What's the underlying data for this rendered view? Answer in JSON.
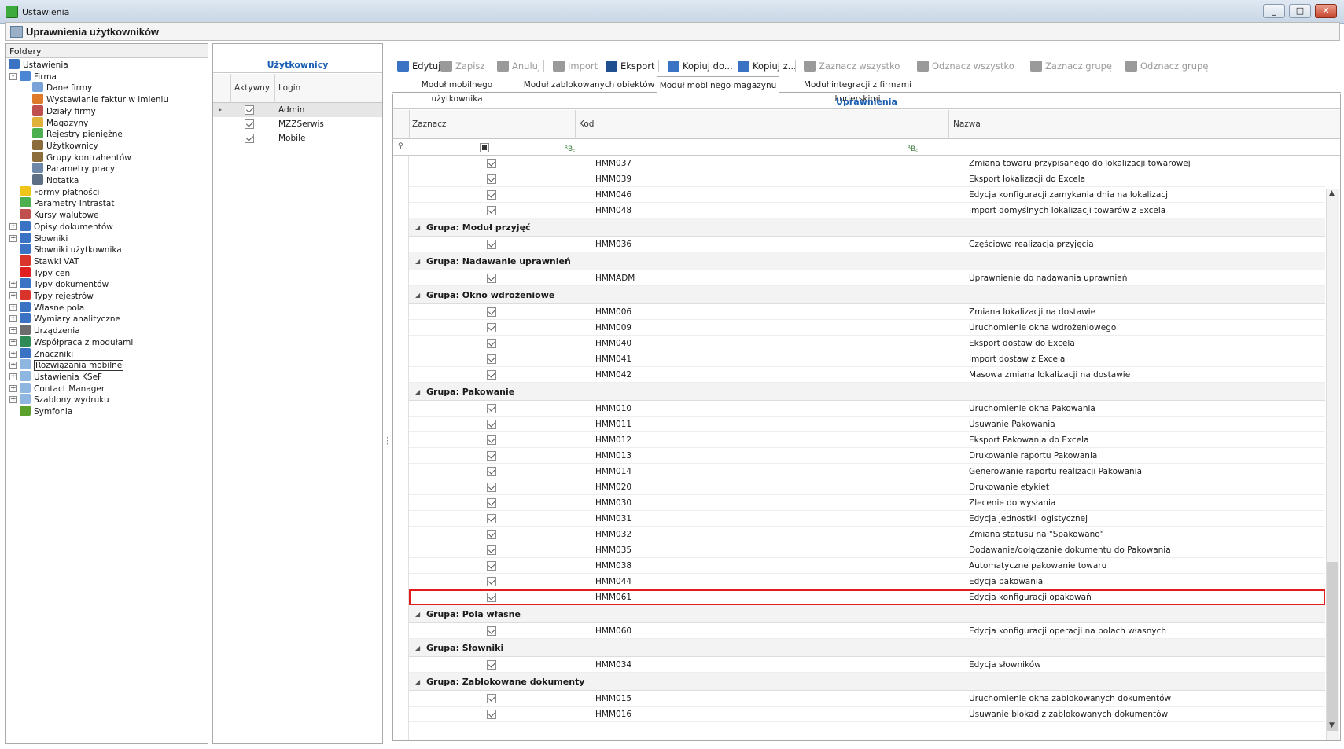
{
  "window": {
    "title": "Ustawienia",
    "controls": [
      "_",
      "□",
      "✕"
    ]
  },
  "header": {
    "title": "Uprawnienia użytkowników"
  },
  "folders": {
    "label": "Foldery",
    "items": [
      {
        "label": "Ustawienia",
        "depth": 0,
        "icon": "tools-icon",
        "color": "#3a73c4"
      },
      {
        "label": "Firma",
        "depth": 1,
        "icon": "company-icon",
        "color": "#4a86d4",
        "expander": "-"
      },
      {
        "label": "Dane firmy",
        "depth": 2,
        "icon": "document-icon",
        "color": "#7aa2d8"
      },
      {
        "label": "Wystawianie faktur w imieniu",
        "depth": 2,
        "icon": "person-icon",
        "color": "#e07a2b"
      },
      {
        "label": "Działy firmy",
        "depth": 2,
        "icon": "people-icon",
        "color": "#c0504d"
      },
      {
        "label": "Magazyny",
        "depth": 2,
        "icon": "warehouse-icon",
        "color": "#e0b23a"
      },
      {
        "label": "Rejestry pieniężne",
        "depth": 2,
        "icon": "money-icon",
        "color": "#4caf50"
      },
      {
        "label": "Użytkownicy",
        "depth": 2,
        "icon": "users-icon",
        "color": "#8a6d3b"
      },
      {
        "label": "Grupy kontrahentów",
        "depth": 2,
        "icon": "groups-icon",
        "color": "#8a6d3b"
      },
      {
        "label": "Parametry pracy",
        "depth": 2,
        "icon": "params-icon",
        "color": "#6d87a8"
      },
      {
        "label": "Notatka",
        "depth": 2,
        "icon": "note-icon",
        "color": "#5c6f85"
      },
      {
        "label": "Formy płatności",
        "depth": 1,
        "icon": "payment-icon",
        "color": "#f0c419"
      },
      {
        "label": "Parametry Intrastat",
        "depth": 1,
        "icon": "intrastat-icon",
        "color": "#4caf50"
      },
      {
        "label": "Kursy walutowe",
        "depth": 1,
        "icon": "chart-icon",
        "color": "#c0504d"
      },
      {
        "label": "Opisy dokumentów",
        "depth": 1,
        "icon": "doc-desc-icon",
        "color": "#3a73c4",
        "expander": "+"
      },
      {
        "label": "Słowniki",
        "depth": 1,
        "icon": "dictionary-icon",
        "color": "#3a73c4",
        "expander": "+"
      },
      {
        "label": "Słowniki użytkownika",
        "depth": 1,
        "icon": "user-dictionary-icon",
        "color": "#3a73c4"
      },
      {
        "label": "Stawki VAT",
        "depth": 1,
        "icon": "vat-icon",
        "color": "#d9342b"
      },
      {
        "label": "Typy cen",
        "depth": 1,
        "icon": "price-icon",
        "color": "#e02020"
      },
      {
        "label": "Typy dokumentów",
        "depth": 1,
        "icon": "doc-types-icon",
        "color": "#3a73c4",
        "expander": "+"
      },
      {
        "label": "Typy rejestrów",
        "depth": 1,
        "icon": "registers-icon",
        "color": "#d9342b",
        "expander": "+"
      },
      {
        "label": "Własne pola",
        "depth": 1,
        "icon": "fields-icon",
        "color": "#3a73c4",
        "expander": "+"
      },
      {
        "label": "Wymiary analityczne",
        "depth": 1,
        "icon": "analytics-icon",
        "color": "#3a73c4",
        "expander": "+"
      },
      {
        "label": "Urządzenia",
        "depth": 1,
        "icon": "printer-icon",
        "color": "#6d6d6d",
        "expander": "+"
      },
      {
        "label": "Współpraca z modułami",
        "depth": 1,
        "icon": "modules-icon",
        "color": "#2e8b57",
        "expander": "+"
      },
      {
        "label": "Znaczniki",
        "depth": 1,
        "icon": "tags-icon",
        "color": "#3a73c4",
        "expander": "+"
      },
      {
        "label": "Rozwiązania mobilne",
        "depth": 1,
        "icon": "folder-icon",
        "color": "#8fb6e0",
        "expander": "+",
        "selected": true
      },
      {
        "label": "Ustawienia KSeF",
        "depth": 1,
        "icon": "folder-icon",
        "color": "#8fb6e0",
        "expander": "+"
      },
      {
        "label": "Contact Manager",
        "depth": 1,
        "icon": "folder-icon",
        "color": "#8fb6e0",
        "expander": "+"
      },
      {
        "label": "Szablony wydruku",
        "depth": 1,
        "icon": "folder-icon",
        "color": "#8fb6e0",
        "expander": "+"
      },
      {
        "label": "Symfonia",
        "depth": 1,
        "icon": "symfonia-icon",
        "color": "#5aa02c"
      }
    ]
  },
  "users": {
    "title": "Użytkownicy",
    "columns": [
      "Aktywny",
      "Login"
    ],
    "rows": [
      {
        "active": true,
        "login": "Admin",
        "selected": true
      },
      {
        "active": true,
        "login": "MZZSerwis"
      },
      {
        "active": true,
        "login": "Mobile"
      }
    ]
  },
  "toolbar": [
    {
      "label": "Edytuj",
      "icon": "edit-icon",
      "enabled": true,
      "color": "#3a73c4"
    },
    {
      "label": "Zapisz",
      "icon": "save-icon",
      "enabled": false,
      "color": "#9a9a9a"
    },
    {
      "label": "Anuluj",
      "icon": "undo-icon",
      "enabled": false,
      "color": "#9a9a9a"
    },
    {
      "label": "Import",
      "icon": "folder-open-icon",
      "enabled": false,
      "color": "#9a9a9a"
    },
    {
      "label": "Eksport",
      "icon": "folder-icon",
      "enabled": true,
      "color": "#1f4f8f"
    },
    {
      "label": "Kopiuj do...",
      "icon": "copy-icon",
      "enabled": true,
      "color": "#3a73c4"
    },
    {
      "label": "Kopiuj z...",
      "icon": "copy-icon",
      "enabled": true,
      "color": "#3a73c4"
    },
    {
      "label": "Zaznacz wszystko",
      "icon": "check-circle-icon",
      "enabled": false,
      "color": "#9a9a9a"
    },
    {
      "label": "Odznacz wszystko",
      "icon": "x-circle-icon",
      "enabled": false,
      "color": "#9a9a9a"
    },
    {
      "label": "Zaznacz grupę",
      "icon": "check-group-icon",
      "enabled": false,
      "color": "#9a9a9a"
    },
    {
      "label": "Odznacz grupę",
      "icon": "uncheck-group-icon",
      "enabled": false,
      "color": "#9a9a9a"
    }
  ],
  "tabs": [
    {
      "label": "Moduł mobilnego użytkownika",
      "active": false
    },
    {
      "label": "Moduł zablokowanych obiektów",
      "active": false
    },
    {
      "label": "Moduł mobilnego magazynu",
      "active": true
    },
    {
      "label": "Moduł integracji z firmami kurierskimi",
      "active": false
    }
  ],
  "permissions": {
    "title": "Uprawnienia",
    "columns": [
      "Zaznacz",
      "Kod",
      "Nazwa"
    ],
    "filter_glyphs": [
      "ᴿB꜀",
      "ᴿB꜀"
    ],
    "entries": [
      {
        "kind": "row",
        "code": "HMM037",
        "name": "Zmiana towaru przypisanego do lokalizacji towarowej"
      },
      {
        "kind": "row",
        "code": "HMM039",
        "name": "Eksport lokalizacji do Excela"
      },
      {
        "kind": "row",
        "code": "HMM046",
        "name": "Edycja konfiguracji zamykania dnia na lokalizacji"
      },
      {
        "kind": "row",
        "code": "HMM048",
        "name": "Import domyślnych lokalizacji towarów z Excela"
      },
      {
        "kind": "group",
        "label": "Grupa: Moduł przyjęć"
      },
      {
        "kind": "row",
        "code": "HMM036",
        "name": "Częściowa realizacja przyjęcia"
      },
      {
        "kind": "group",
        "label": "Grupa: Nadawanie uprawnień"
      },
      {
        "kind": "row",
        "code": "HMMADM",
        "name": "Uprawnienie do nadawania uprawnień"
      },
      {
        "kind": "group",
        "label": "Grupa: Okno wdrożeniowe"
      },
      {
        "kind": "row",
        "code": "HMM006",
        "name": "Zmiana lokalizacji na dostawie"
      },
      {
        "kind": "row",
        "code": "HMM009",
        "name": "Uruchomienie okna wdrożeniowego"
      },
      {
        "kind": "row",
        "code": "HMM040",
        "name": "Eksport dostaw do Excela"
      },
      {
        "kind": "row",
        "code": "HMM041",
        "name": "Import dostaw z Excela"
      },
      {
        "kind": "row",
        "code": "HMM042",
        "name": "Masowa zmiana lokalizacji na dostawie"
      },
      {
        "kind": "group",
        "label": "Grupa: Pakowanie"
      },
      {
        "kind": "row",
        "code": "HMM010",
        "name": "Uruchomienie okna Pakowania"
      },
      {
        "kind": "row",
        "code": "HMM011",
        "name": "Usuwanie Pakowania"
      },
      {
        "kind": "row",
        "code": "HMM012",
        "name": "Eksport Pakowania do Excela"
      },
      {
        "kind": "row",
        "code": "HMM013",
        "name": "Drukowanie raportu Pakowania"
      },
      {
        "kind": "row",
        "code": "HMM014",
        "name": "Generowanie raportu realizacji Pakowania"
      },
      {
        "kind": "row",
        "code": "HMM020",
        "name": "Drukowanie etykiet"
      },
      {
        "kind": "row",
        "code": "HMM030",
        "name": "Zlecenie do wysłania"
      },
      {
        "kind": "row",
        "code": "HMM031",
        "name": "Edycja jednostki logistycznej"
      },
      {
        "kind": "row",
        "code": "HMM032",
        "name": "Zmiana statusu na \"Spakowano\""
      },
      {
        "kind": "row",
        "code": "HMM035",
        "name": "Dodawanie/dołączanie dokumentu do Pakowania"
      },
      {
        "kind": "row",
        "code": "HMM038",
        "name": "Automatyczne pakowanie towaru"
      },
      {
        "kind": "row",
        "code": "HMM044",
        "name": "Edycja pakowania"
      },
      {
        "kind": "row",
        "code": "HMM061",
        "name": "Edycja konfiguracji opakowań",
        "highlighted": true
      },
      {
        "kind": "group",
        "label": "Grupa: Pola własne"
      },
      {
        "kind": "row",
        "code": "HMM060",
        "name": "Edycja konfiguracji operacji na polach własnych"
      },
      {
        "kind": "group",
        "label": "Grupa: Słowniki"
      },
      {
        "kind": "row",
        "code": "HMM034",
        "name": "Edycja słowników"
      },
      {
        "kind": "group",
        "label": "Grupa: Zablokowane dokumenty"
      },
      {
        "kind": "row",
        "code": "HMM015",
        "name": "Uruchomienie okna zablokowanych dokumentów"
      },
      {
        "kind": "row",
        "code": "HMM016",
        "name": "Usuwanie blokad z zablokowanych dokumentów"
      }
    ]
  },
  "colors": {
    "accent": "#1a5fb4",
    "highlight": "#e21b1b"
  }
}
